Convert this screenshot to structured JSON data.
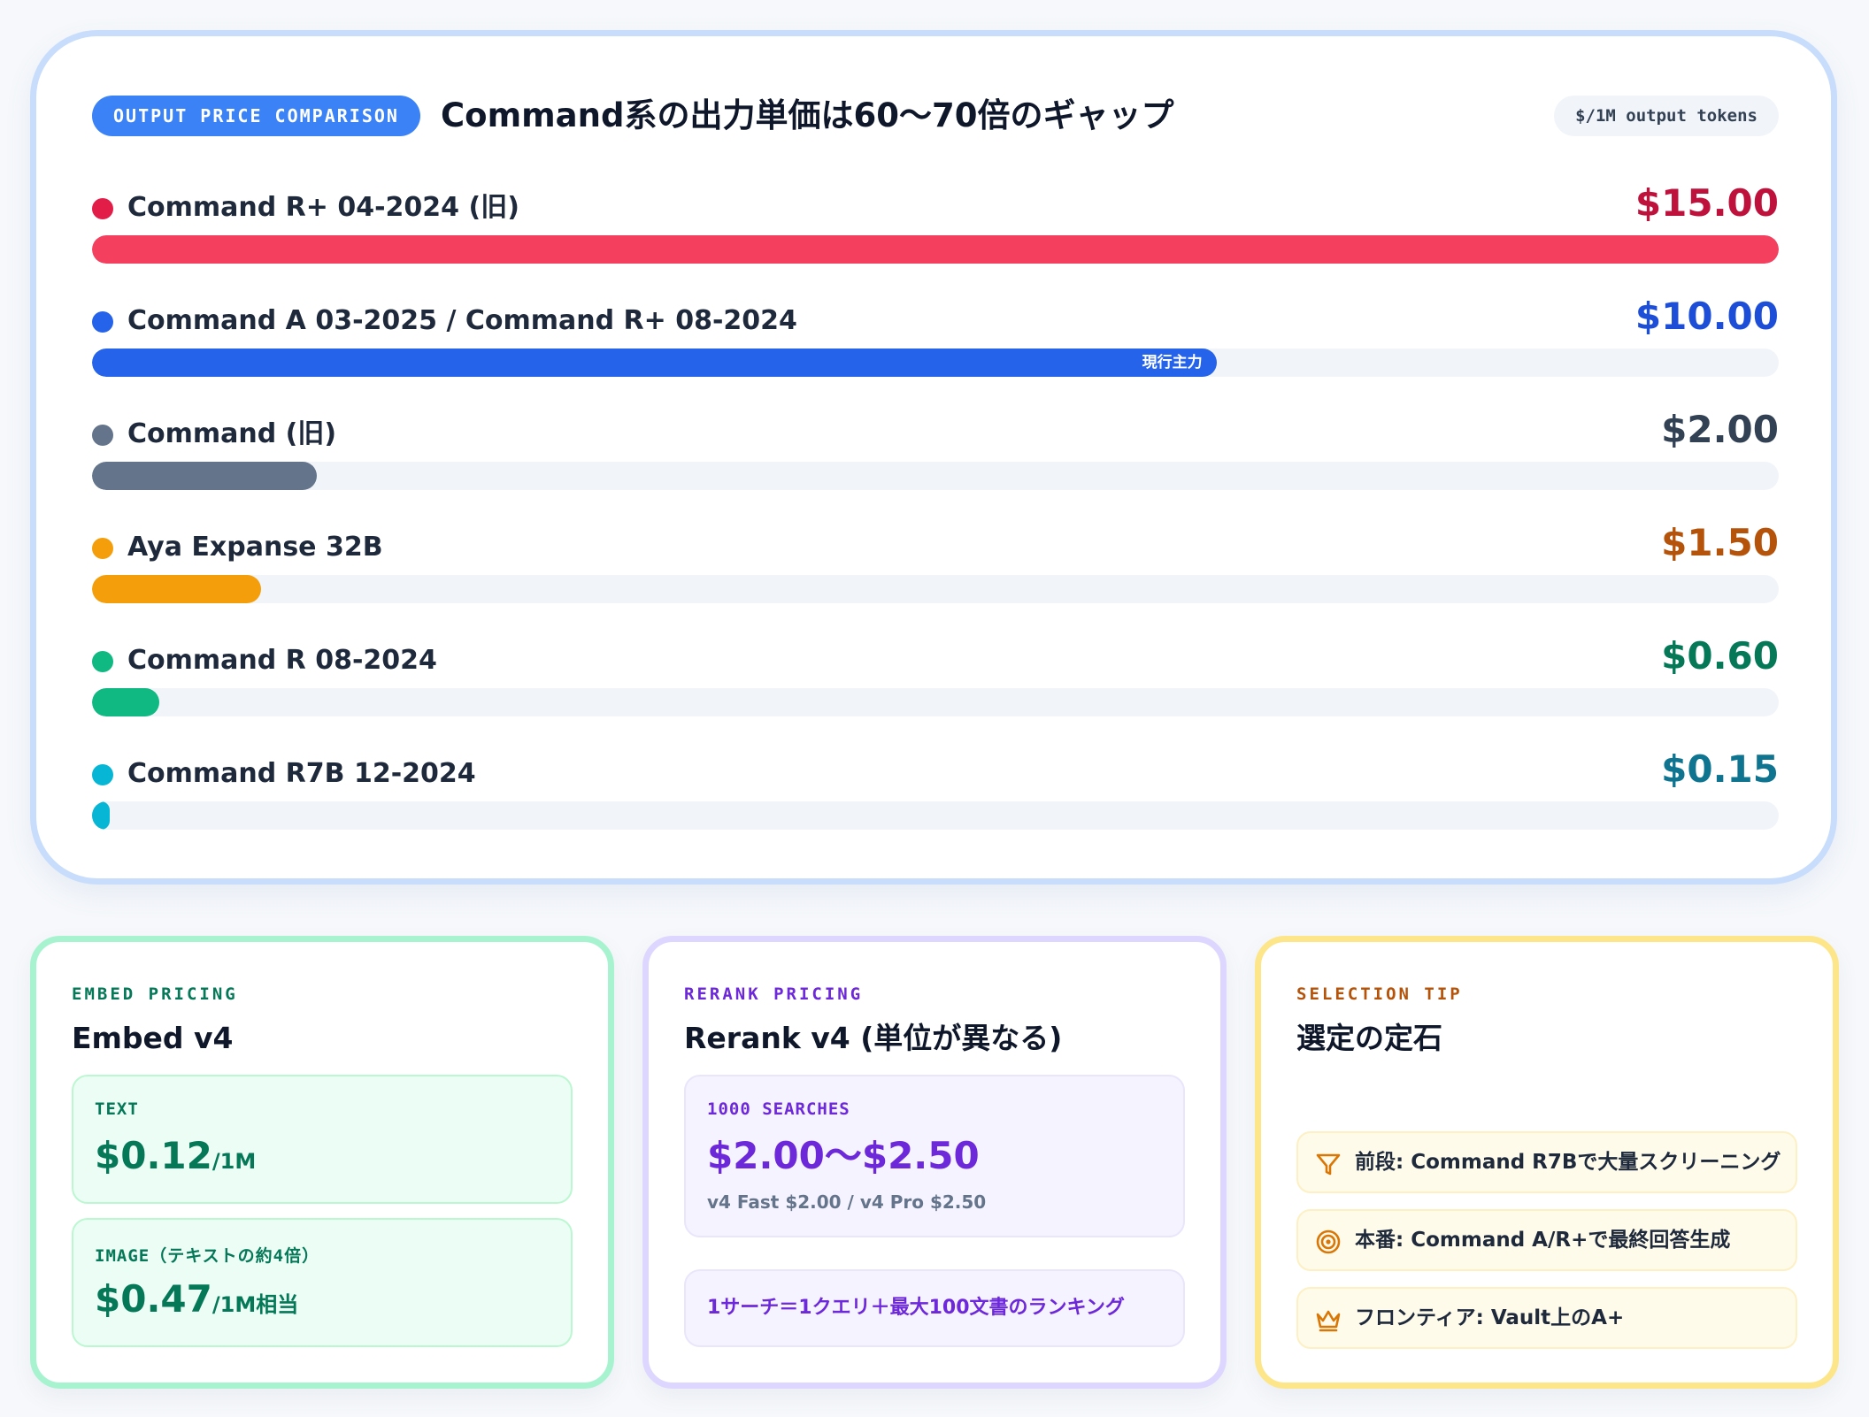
{
  "comparison": {
    "badge": "OUTPUT PRICE COMPARISON",
    "title": "Command系の出力単価は60〜70倍のギャップ",
    "unit": "$/1M output tokens",
    "colors": {
      "accent": "#3b82f6"
    },
    "rows": [
      {
        "label": "Command R+ 04-2024 (旧)",
        "price_text": "$15.00",
        "value": 15.0,
        "dot": "#e11d48",
        "bar": "#f43f5e",
        "text_color": "#be123c",
        "tag": ""
      },
      {
        "label": "Command A 03-2025 / Command R+ 08-2024",
        "price_text": "$10.00",
        "value": 10.0,
        "dot": "#2563eb",
        "bar": "#2563eb",
        "text_color": "#1d4ed8",
        "tag": "現行主力"
      },
      {
        "label": "Command (旧)",
        "price_text": "$2.00",
        "value": 2.0,
        "dot": "#64748b",
        "bar": "#64748b",
        "text_color": "#334155",
        "tag": ""
      },
      {
        "label": "Aya Expanse 32B",
        "price_text": "$1.50",
        "value": 1.5,
        "dot": "#f59e0b",
        "bar": "#f59e0b",
        "text_color": "#b45309",
        "tag": ""
      },
      {
        "label": "Command R 08-2024",
        "price_text": "$0.60",
        "value": 0.6,
        "dot": "#10b981",
        "bar": "#10b981",
        "text_color": "#047857",
        "tag": ""
      },
      {
        "label": "Command R7B 12-2024",
        "price_text": "$0.15",
        "value": 0.15,
        "dot": "#06b6d4",
        "bar": "#06b6d4",
        "text_color": "#0e7490",
        "tag": ""
      }
    ],
    "max_value": 15.0
  },
  "embed": {
    "eyebrow": "EMBED PRICING",
    "title": "Embed v4",
    "text_label": "TEXT",
    "text_value": "$0.12",
    "text_unit": "/1M",
    "image_label": "IMAGE（テキストの約4倍）",
    "image_value": "$0.47",
    "image_unit": "/1M相当",
    "colors": {
      "border": "#a7f3d0",
      "accent": "#047857",
      "bg": "#ecfdf5",
      "sub_border": "#bbf7d0"
    }
  },
  "rerank": {
    "eyebrow": "RERANK PRICING",
    "title": "Rerank v4 (単位が異なる)",
    "searches_label": "1000 SEARCHES",
    "searches_value": "$2.00〜$2.50",
    "searches_note": "v4 Fast $2.00 / v4 Pro $2.50",
    "definition": "1サーチ＝1クエリ＋最大100文書のランキング",
    "colors": {
      "border": "#ddd6fe",
      "accent": "#6d28d9",
      "bg": "#f5f3ff",
      "sub_border": "#e9e5fb"
    }
  },
  "tips": {
    "eyebrow": "SELECTION TIP",
    "title": "選定の定石",
    "items": [
      {
        "icon": "filter-icon",
        "text": "前段: Command R7Bで大量スクリーニング"
      },
      {
        "icon": "target-icon",
        "text": "本番: Command A/R+で最終回答生成"
      },
      {
        "icon": "crown-icon",
        "text": "フロンティア: Vault上のA+"
      }
    ],
    "colors": {
      "border": "#fde68a",
      "accent": "#b45309",
      "icon": "#d97706"
    }
  }
}
